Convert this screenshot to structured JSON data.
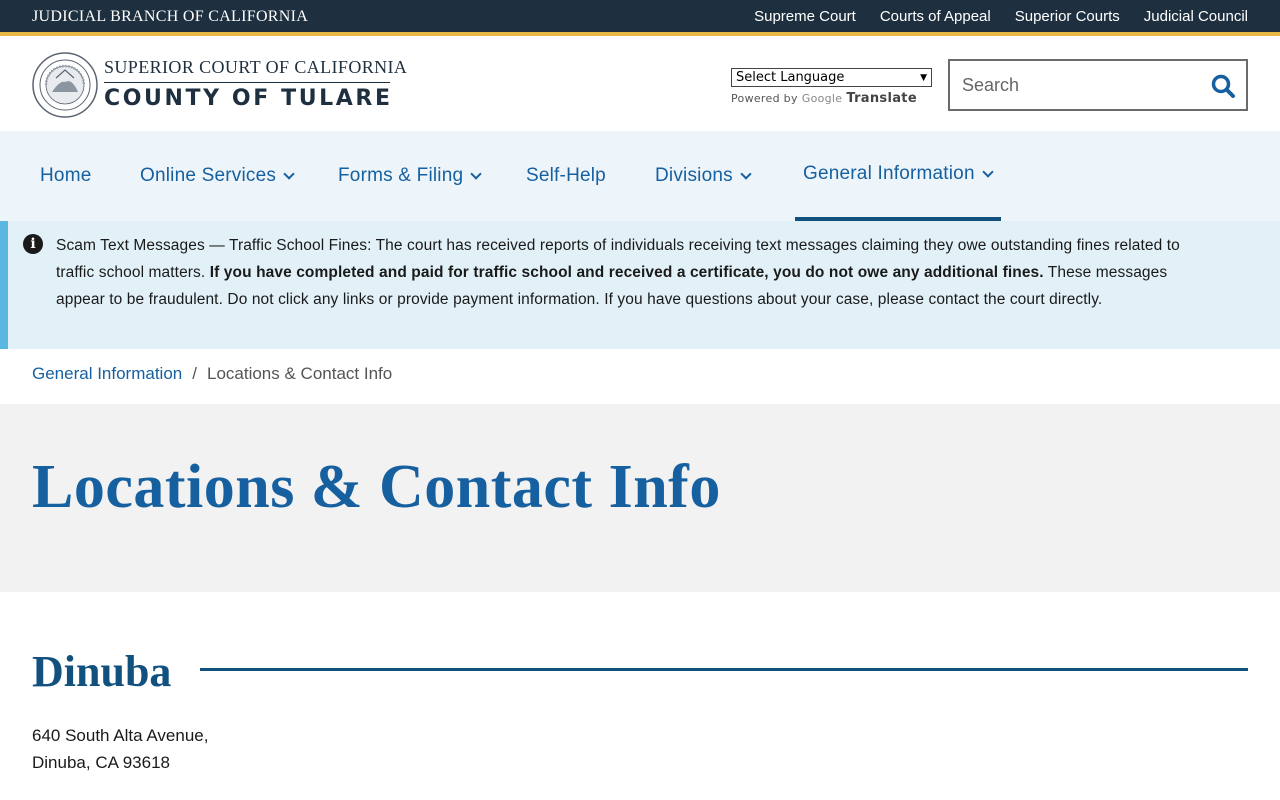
{
  "topbar": {
    "title": "JUDICIAL BRANCH OF CALIFORNIA",
    "links": [
      "Supreme Court",
      "Courts of Appeal",
      "Superior Courts",
      "Judicial Council"
    ]
  },
  "header": {
    "logo_line1": "SUPERIOR COURT OF CALIFORNIA",
    "logo_line2": "COUNTY OF TULARE",
    "language_select": "Select Language",
    "powered_by": "Powered by",
    "google": "Google",
    "translate": "Translate",
    "search_placeholder": "Search"
  },
  "nav": {
    "items": [
      {
        "label": "Home"
      },
      {
        "label": "Online Services"
      },
      {
        "label": "Forms & Filing"
      },
      {
        "label": "Self-Help"
      },
      {
        "label": "Divisions"
      },
      {
        "label": "General Information"
      }
    ]
  },
  "alert": {
    "lead": "Scam Text Messages — Traffic School Fines:",
    "text1": " The court has received reports of individuals receiving text messages claiming they owe outstanding fines related to traffic school matters. ",
    "bold": "If you have completed and paid for traffic school and received a certificate, you do not owe any additional fines.",
    "text2": " These messages appear to be fraudulent. Do not click any links or provide payment information. If you have questions about your case, please contact the court directly."
  },
  "breadcrumb": {
    "parent": "General Information",
    "separator": "/",
    "current": "Locations & Contact Info"
  },
  "page": {
    "title": "Locations & Contact Info"
  },
  "section": {
    "title": "Dinuba",
    "address_line1": "640 South Alta Avenue,",
    "address_line2": "Dinuba, CA 93618"
  },
  "colors": {
    "topbar": "#1e2f3f",
    "accent_gold": "#e8b847",
    "link_blue": "#1660a0",
    "nav_bg": "#eef5fa",
    "alert_bg": "#e2f1f8",
    "alert_border": "#5ab8e0"
  }
}
